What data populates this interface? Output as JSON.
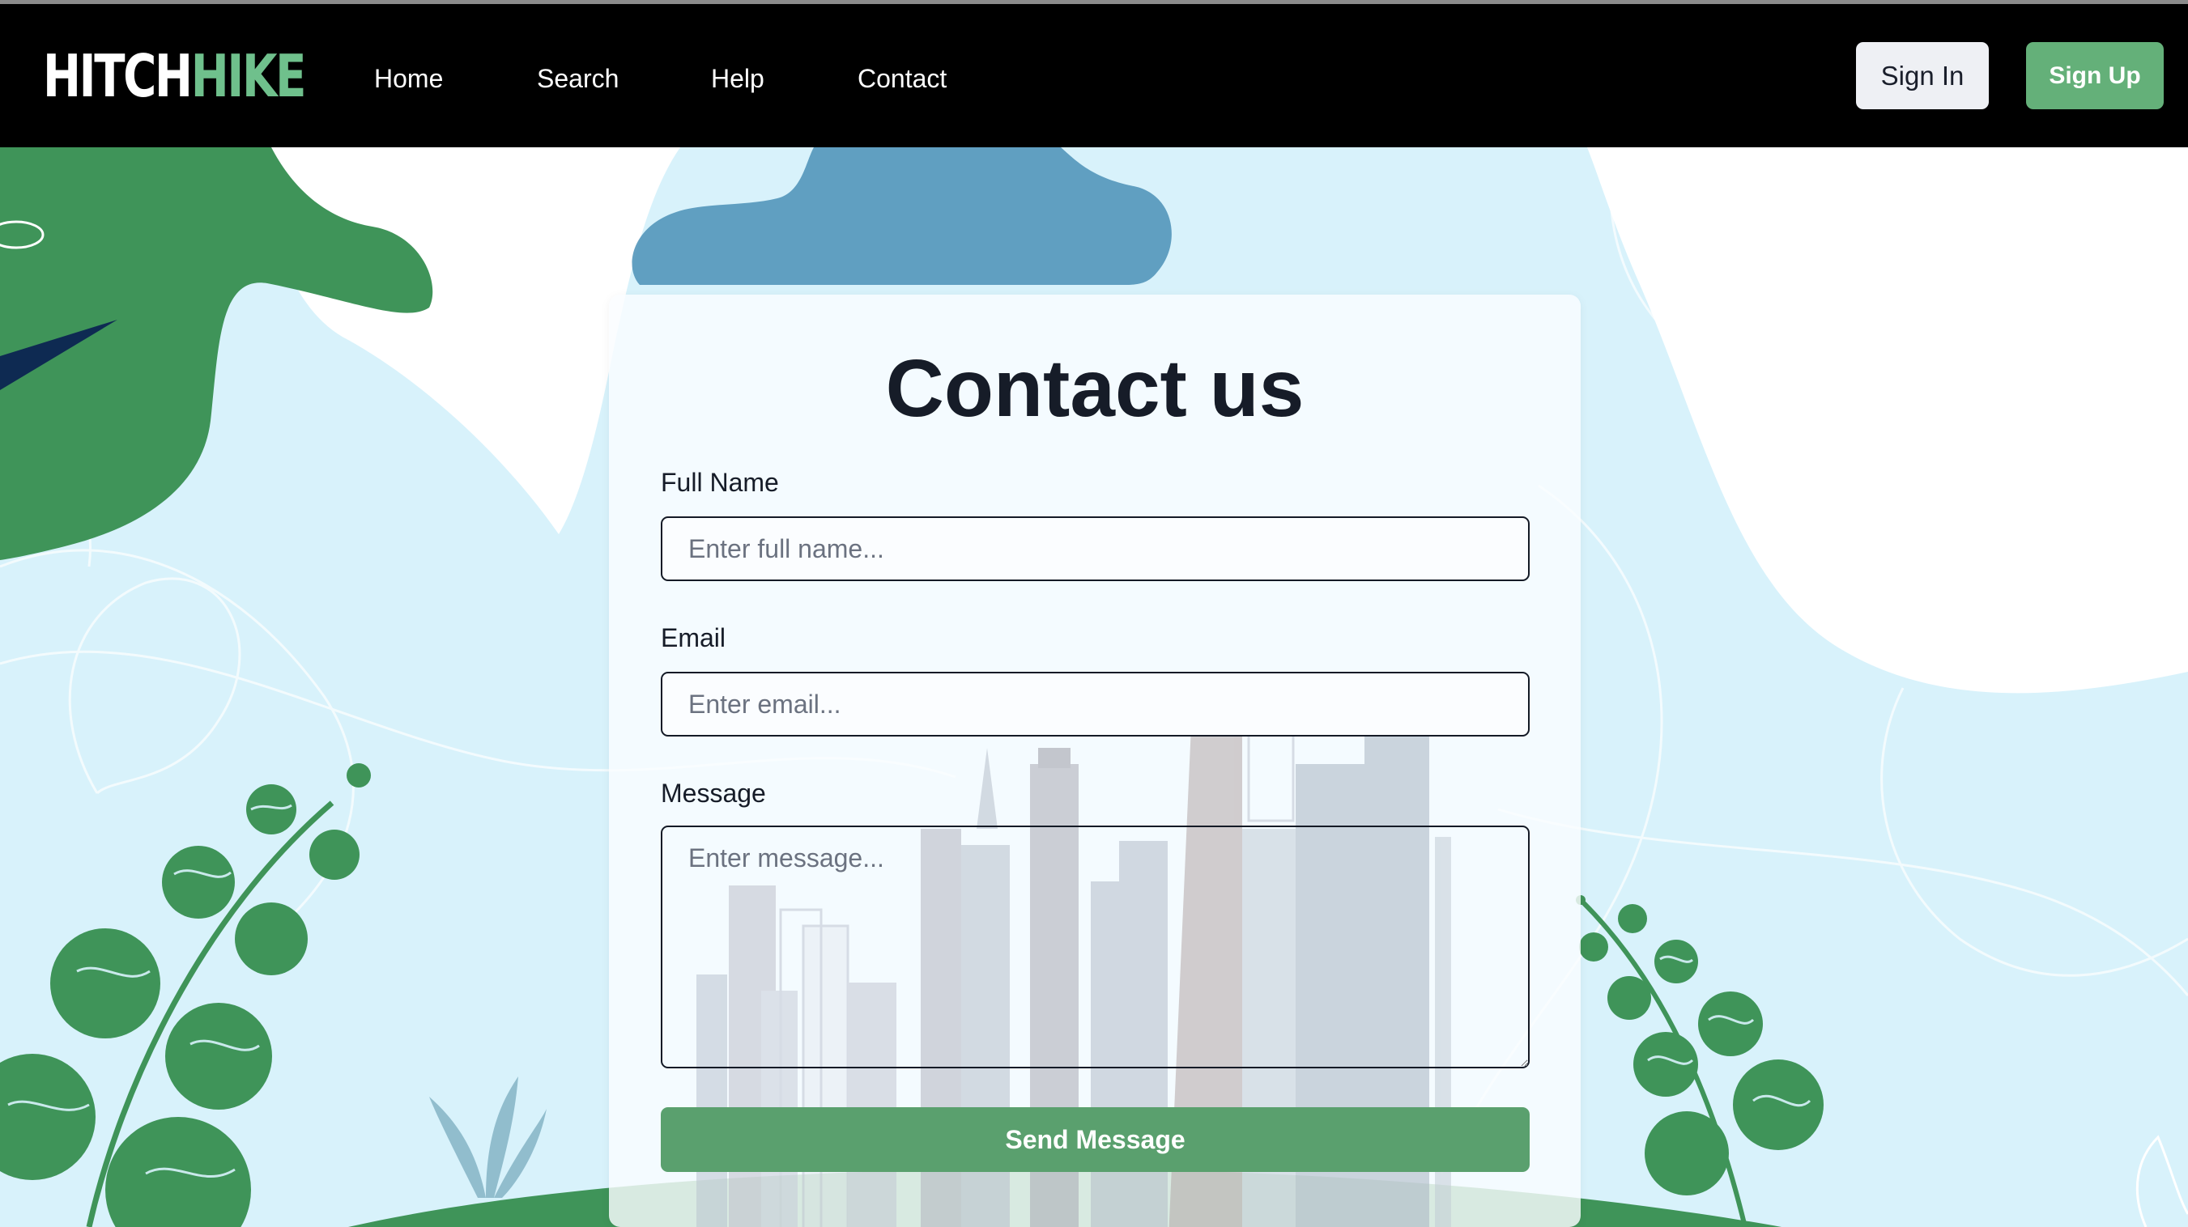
{
  "brand": {
    "part1": "HITCH",
    "part2": "HIKE"
  },
  "nav": {
    "links": [
      {
        "label": "Home"
      },
      {
        "label": "Search"
      },
      {
        "label": "Help"
      },
      {
        "label": "Contact"
      }
    ],
    "sign_in": "Sign In",
    "sign_up": "Sign Up"
  },
  "contact": {
    "title": "Contact us",
    "full_name": {
      "label": "Full Name",
      "placeholder": "Enter full name...",
      "value": ""
    },
    "email": {
      "label": "Email",
      "placeholder": "Enter email...",
      "value": ""
    },
    "message": {
      "label": "Message",
      "placeholder": "Enter message...",
      "value": ""
    },
    "submit": "Send Message"
  },
  "colors": {
    "nav_bg": "#000000",
    "brand_accent": "#6fc08c",
    "primary_button": "#5aa06e",
    "background": "#d8f2fb",
    "leaf_green": "#3e9459",
    "cloud_blue": "#4f93b8"
  }
}
